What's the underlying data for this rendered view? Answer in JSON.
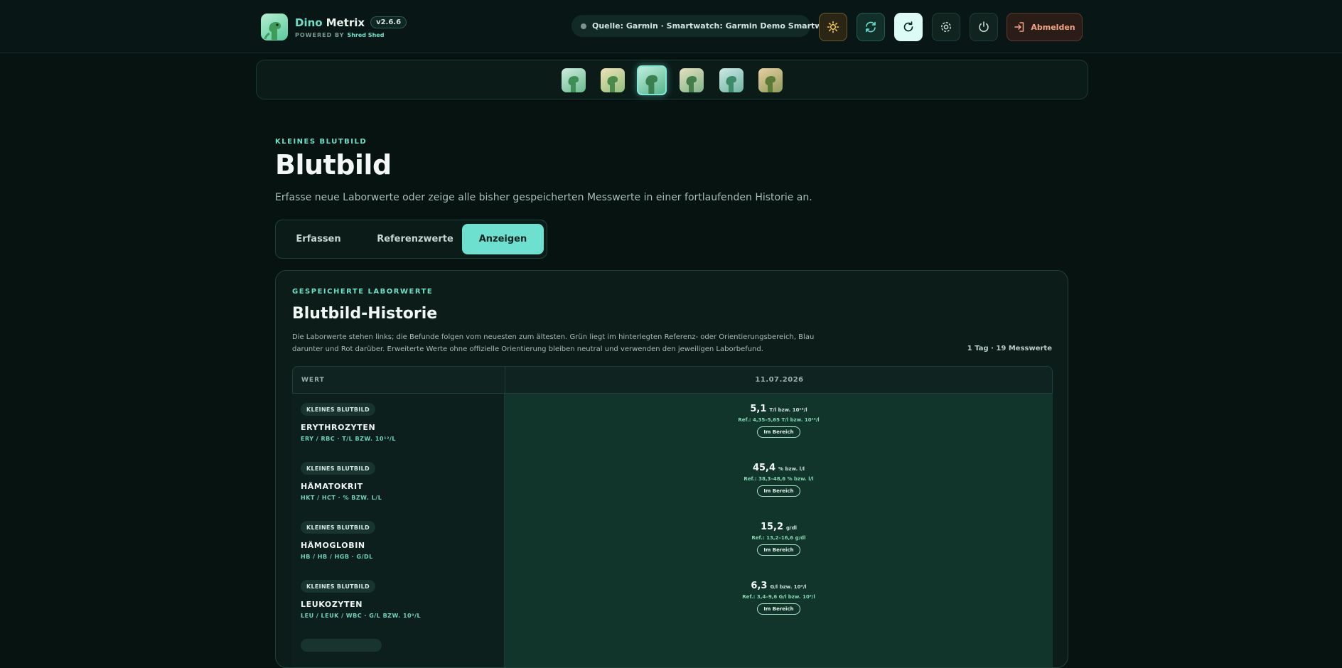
{
  "brand": {
    "name_part1": "Dino",
    "name_part2": "Metrix",
    "version": "v2.6.6",
    "powered_by": "POWERED BY",
    "powered_name": "Shred Shed"
  },
  "source": {
    "text": "Quelle: Garmin · Smartwatch: Garmin Demo Smartwatch"
  },
  "toolbar": {
    "logout_label": "Abmelden"
  },
  "avatars": [
    {
      "icon": "dino-avatar-1",
      "active": false
    },
    {
      "icon": "dino-avatar-2",
      "active": false
    },
    {
      "icon": "dino-avatar-3",
      "active": true
    },
    {
      "icon": "dino-avatar-4",
      "active": false
    },
    {
      "icon": "dino-avatar-5",
      "active": false
    },
    {
      "icon": "dino-avatar-6",
      "active": false
    }
  ],
  "page": {
    "eyebrow": "KLEINES BLUTBILD",
    "title": "Blutbild",
    "subtitle": "Erfasse neue Laborwerte oder zeige alle bisher gespeicherten Messwerte in einer fortlaufenden Historie an."
  },
  "tabs": [
    {
      "label": "Erfassen",
      "active": false
    },
    {
      "label": "Referenzwerte",
      "active": false
    },
    {
      "label": "Anzeigen",
      "active": true
    }
  ],
  "history": {
    "eyebrow": "GESPEICHERTE LABORWERTE",
    "title": "Blutbild-Historie",
    "description": "Die Laborwerte stehen links; die Befunde folgen vom neuesten zum ältesten. Grün liegt im hinterlegten Referenz- oder Orientierungsbereich, Blau darunter und Rot darüber. Erweiterte Werte ohne offizielle Orientierung bleiben neutral und verwenden den jeweiligen Laborbefund.",
    "count": "1 Tag · 19 Messwerte",
    "col_value": "WERT",
    "col_date": "11.07.2026",
    "rows": [
      {
        "category": "KLEINES BLUTBILD",
        "name": "ERYTHROZYTEN",
        "codes": "ERY / RBC · T/L BZW. 10¹²/L",
        "value": "5,1",
        "unit": "T/l bzw. 10¹²/l",
        "ref": "Ref.: 4,35–5,65 T/l bzw. 10¹²/l",
        "status": "Im Bereich"
      },
      {
        "category": "KLEINES BLUTBILD",
        "name": "HÄMATOKRIT",
        "codes": "HKT / HCT · % BZW. L/L",
        "value": "45,4",
        "unit": "% bzw. l/l",
        "ref": "Ref.: 38,3–48,6 % bzw. l/l",
        "status": "Im Bereich"
      },
      {
        "category": "KLEINES BLUTBILD",
        "name": "HÄMOGLOBIN",
        "codes": "HB / HB / HGB · G/DL",
        "value": "15,2",
        "unit": "g/dl",
        "ref": "Ref.: 13,2–16,6 g/dl",
        "status": "Im Bereich"
      },
      {
        "category": "KLEINES BLUTBILD",
        "name": "LEUKOZYTEN",
        "codes": "LEU / LEUK / WBC · G/L BZW. 10⁹/L",
        "value": "6,3",
        "unit": "G/l bzw. 10⁹/l",
        "ref": "Ref.: 3,4–9,6 G/l bzw. 10⁹/l",
        "status": "Im Bereich"
      }
    ]
  },
  "colors": {
    "accent": "#6ee0cf",
    "background": "#061311",
    "in_range": "#11342b",
    "logout": "#f1a487"
  }
}
